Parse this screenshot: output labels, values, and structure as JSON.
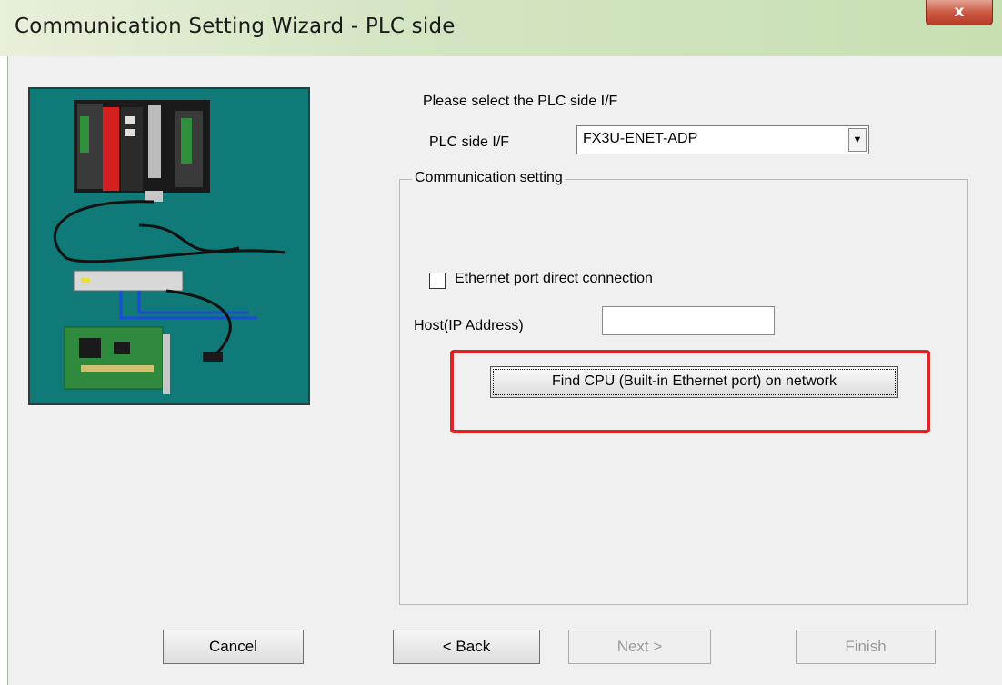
{
  "window": {
    "title": "Communication Setting Wizard - PLC side",
    "close_glyph": "x"
  },
  "prompt": "Please select the PLC side I/F",
  "plc_side_if": {
    "label": "PLC side I/F",
    "selected": "FX3U-ENET-ADP"
  },
  "communication_setting": {
    "legend": "Communication setting",
    "ethernet_direct": {
      "label": "Ethernet port direct connection",
      "checked": false
    },
    "host": {
      "label": "Host(IP Address)",
      "value": ""
    },
    "find_cpu_button": "Find CPU (Built-in Ethernet port) on network"
  },
  "buttons": {
    "cancel": "Cancel",
    "back": "< Back",
    "next": "Next >",
    "finish": "Finish"
  },
  "colors": {
    "illustration_bg": "#0f7a78",
    "highlight": "#e02424"
  }
}
